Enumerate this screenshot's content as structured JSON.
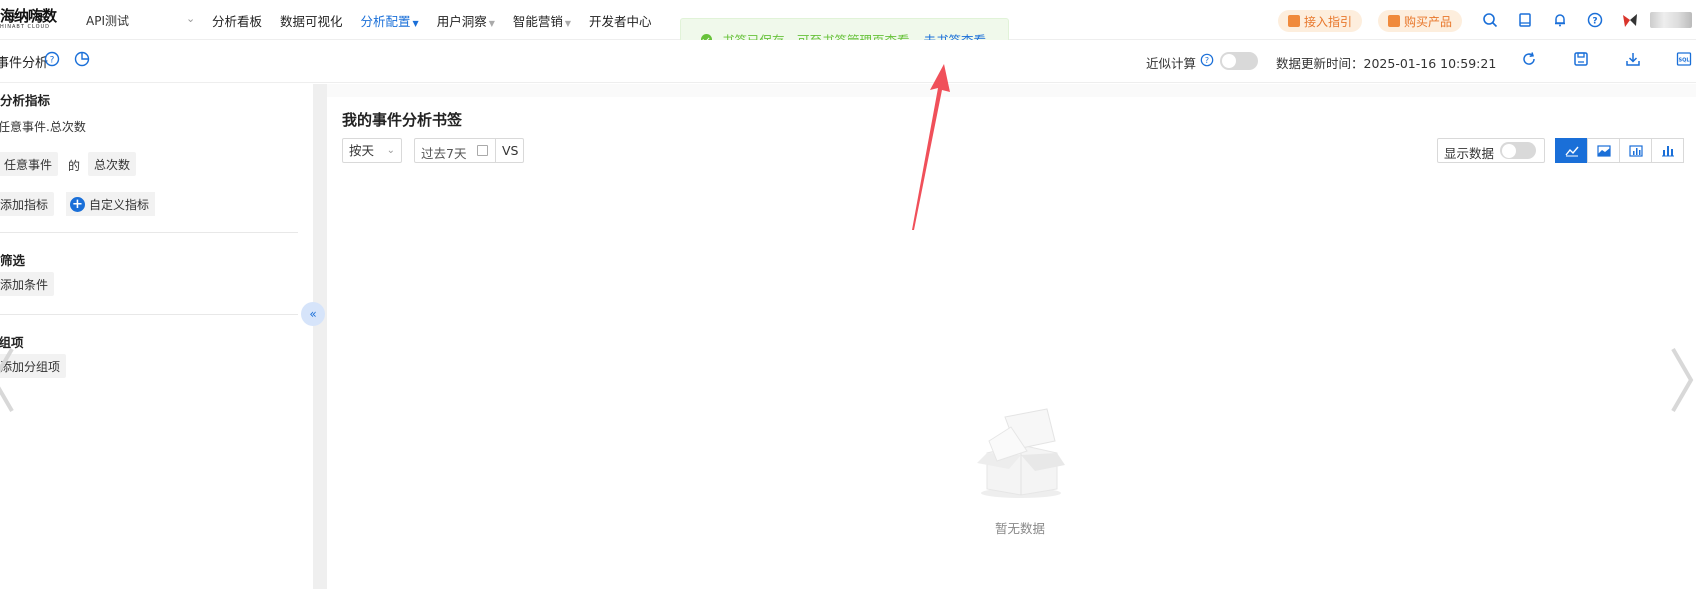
{
  "brand": {
    "logo_text": "海纳嗨数",
    "logo_sub": "HINABT CLOUD"
  },
  "project": {
    "name": "API测试"
  },
  "nav": {
    "items": [
      {
        "label": "分析看板",
        "has_caret": false,
        "active": false
      },
      {
        "label": "数据可视化",
        "has_caret": false,
        "active": false
      },
      {
        "label": "分析配置",
        "has_caret": true,
        "active": true
      },
      {
        "label": "用户洞察",
        "has_caret": true,
        "active": false
      },
      {
        "label": "智能营销",
        "has_caret": true,
        "active": false
      },
      {
        "label": "开发者中心",
        "has_caret": false,
        "active": false
      }
    ]
  },
  "header_actions": {
    "access_guide": "接入指引",
    "buy_product": "购买产品"
  },
  "toolbar": {
    "page_title": "事件分析",
    "approx_calc": "近似计算",
    "update_time_label": "数据更新时间：",
    "update_time_value": "2025-01-16 10:59:21"
  },
  "left_panel": {
    "metrics_title": "分析指标",
    "metric_name": "任意事件.总次数",
    "metric_event": "任意事件",
    "metric_of": "的",
    "metric_agg": "总次数",
    "add_metric": "添加指标",
    "custom_metric": "自定义指标",
    "filter_title": "筛选",
    "add_condition": "添加条件",
    "group_title": "分组项",
    "add_group": "添加分组项"
  },
  "main": {
    "bookmark_title": "我的事件分析书签",
    "granularity": "按天",
    "date_range": "过去7天",
    "compare": "VS",
    "show_data": "显示数据",
    "empty_text": "暂无数据"
  },
  "toast": {
    "message": "书签已保存，可至书签管理页查看",
    "link": "去书签查看"
  },
  "colors": {
    "primary": "#1a6fd8",
    "success": "#67c23a",
    "orange": "#e8772b",
    "arrow": "#f0505a"
  }
}
